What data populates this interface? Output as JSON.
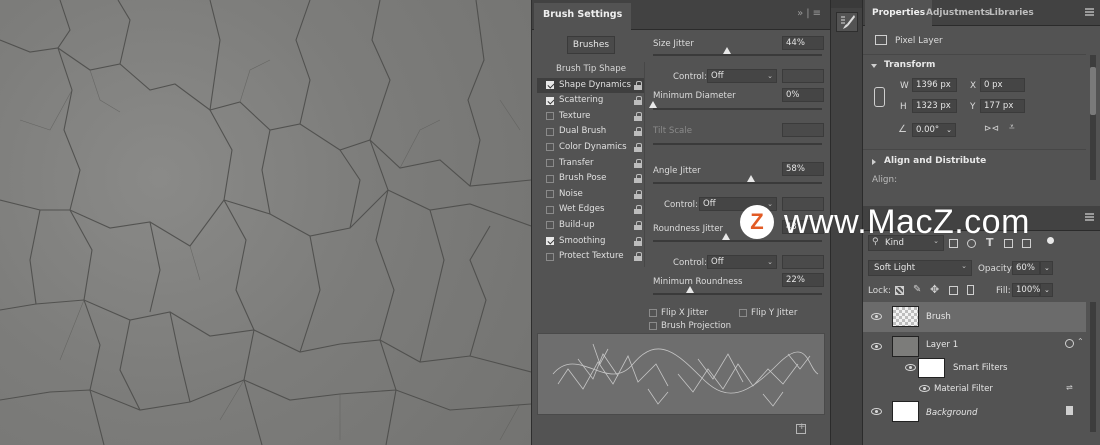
{
  "brush_settings": {
    "tab": "Brush Settings",
    "brushes_button": "Brushes",
    "list": [
      {
        "label": "Brush Tip Shape",
        "header": true
      },
      {
        "label": "Shape Dynamics",
        "checked": true,
        "selected": true
      },
      {
        "label": "Scattering",
        "checked": true
      },
      {
        "label": "Texture",
        "checked": false
      },
      {
        "label": "Dual Brush",
        "checked": false
      },
      {
        "label": "Color Dynamics",
        "checked": false
      },
      {
        "label": "Transfer",
        "checked": false
      },
      {
        "label": "Brush Pose",
        "checked": false
      },
      {
        "label": "Noise",
        "checked": false
      },
      {
        "label": "Wet Edges",
        "checked": false
      },
      {
        "label": "Build-up",
        "checked": false
      },
      {
        "label": "Smoothing",
        "checked": true
      },
      {
        "label": "Protect Texture",
        "checked": false
      }
    ],
    "size_jitter": {
      "label": "Size Jitter",
      "value": "44%",
      "level": 0.44
    },
    "control_1": {
      "label": "Control:",
      "value": "Off"
    },
    "min_diameter": {
      "label": "Minimum Diameter",
      "value": "0%",
      "level": 0.0
    },
    "tilt_scale": {
      "label": "Tilt Scale"
    },
    "angle_jitter": {
      "label": "Angle Jitter",
      "value": "58%",
      "level": 0.58
    },
    "control_2": {
      "label": "Control:",
      "value": "Off"
    },
    "roundness_jitter": {
      "label": "Roundness Jitter",
      "value": "43",
      "level": 0.43
    },
    "control_3": {
      "label": "Control:",
      "value": "Off"
    },
    "min_roundness": {
      "label": "Minimum Roundness",
      "value": "22%",
      "level": 0.22
    },
    "flip_x": "Flip X Jitter",
    "flip_y": "Flip Y Jitter",
    "projection": "Brush Projection"
  },
  "properties": {
    "tabs": [
      "Properties",
      "Adjustments",
      "Libraries"
    ],
    "layer_type": "Pixel Layer",
    "transform_title": "Transform",
    "w_label": "W",
    "w_value": "1396 px",
    "x_label": "X",
    "x_value": "0 px",
    "h_label": "H",
    "h_value": "1323 px",
    "y_label": "Y",
    "y_value": "177 px",
    "angle_value": "0.00°",
    "align_title": "Align and Distribute",
    "align_label": "Align:"
  },
  "layers": {
    "kind_label": "Kind",
    "blend_mode": "Soft Light",
    "opacity_label": "Opacity:",
    "opacity_value": "60%",
    "lock_label": "Lock:",
    "fill_label": "Fill:",
    "fill_value": "100%",
    "items": [
      {
        "name": "Brush"
      },
      {
        "name": "Layer 1"
      },
      {
        "name": "Smart Filters"
      },
      {
        "name": "Material Filter"
      },
      {
        "name": "Background"
      }
    ]
  },
  "watermark": {
    "logo_letter": "Z",
    "text": "www.MacZ.com"
  },
  "colors": {
    "panel": "#535353",
    "header": "#424242",
    "selected_layer": "#6b6b6b",
    "watermark_orange": "#e25b25"
  }
}
